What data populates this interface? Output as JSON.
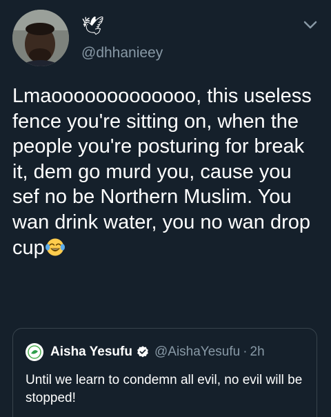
{
  "author": {
    "display_name": "🕊",
    "handle": "@dhhanieey"
  },
  "tweet": {
    "text": "Lmaooooooooooooo, this useless fence you're sitting on, when the people you're posturing for break it, dem go murd you, cause you sef no be Northern Muslim. You wan drink water, you no wan drop cup",
    "emoji": "face-with-tears-of-joy-emoji"
  },
  "quoted_tweet": {
    "name": "Aisha Yesufu",
    "handle": "@AishaYesufu",
    "separator": "·",
    "time": "2h",
    "text": "Until we learn to condemn all evil, no evil will be stopped!"
  },
  "colors": {
    "background": "#15202b",
    "text": "#ffffff",
    "secondary_text": "#8899a6",
    "border": "#38444d",
    "verified": "#ffffff"
  },
  "icons": {
    "menu": "chevron-down-icon",
    "verified": "verified-badge-icon"
  }
}
